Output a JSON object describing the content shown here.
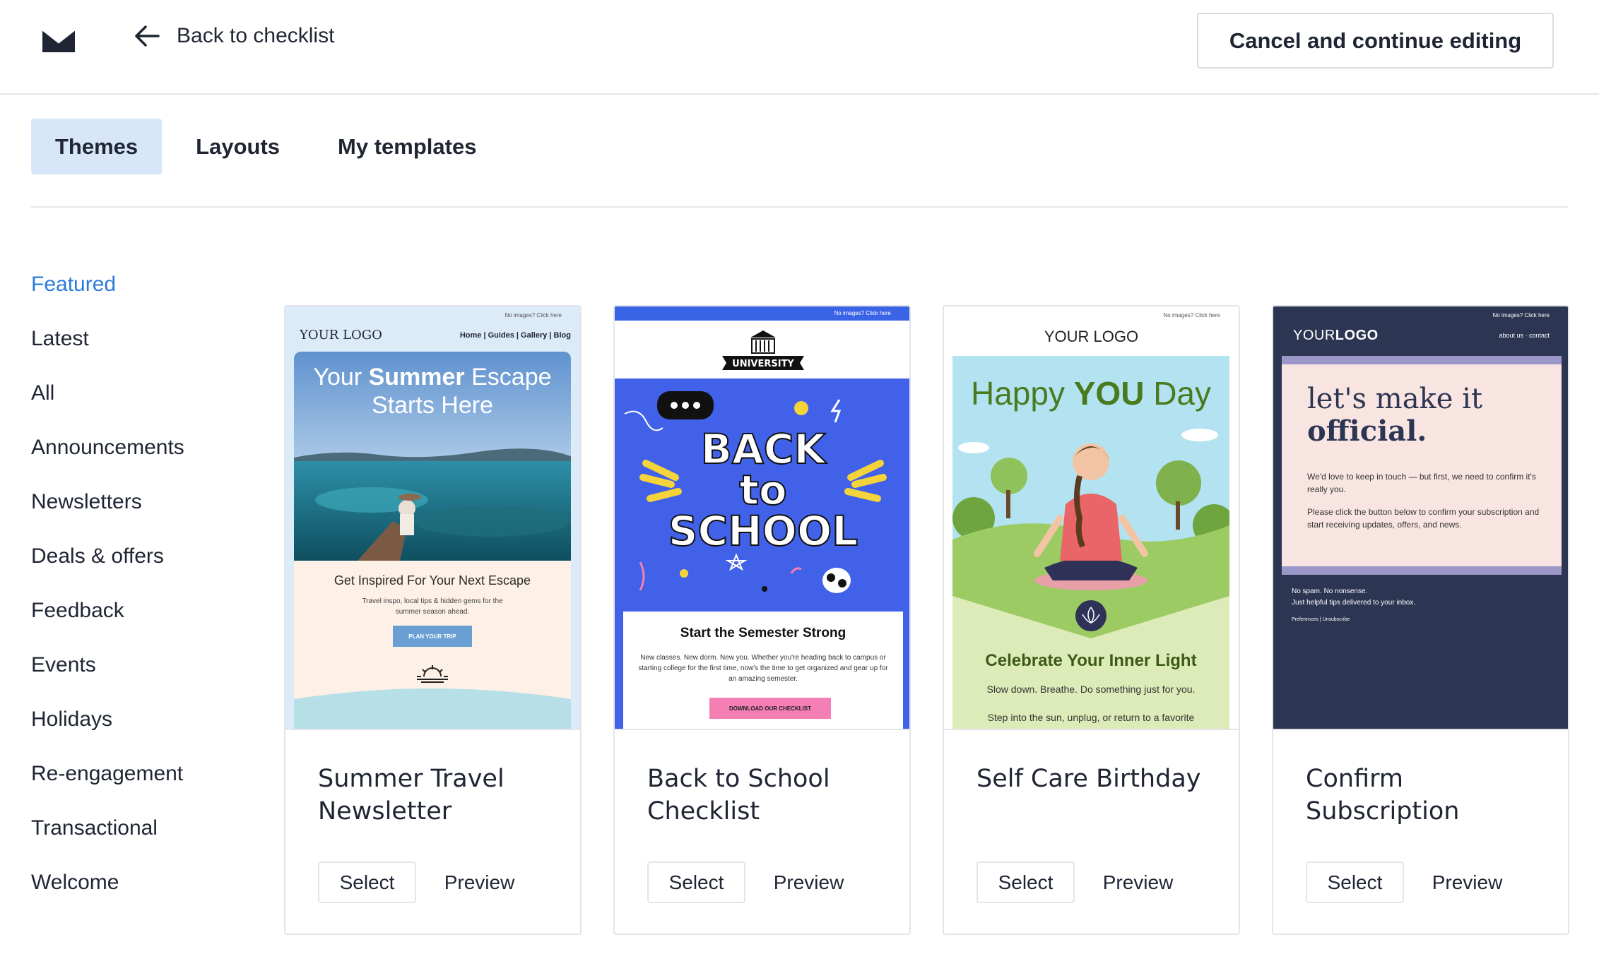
{
  "header": {
    "back_label": "Back to checklist",
    "cancel_label": "Cancel and continue editing"
  },
  "tabs": [
    {
      "label": "Themes",
      "active": true
    },
    {
      "label": "Layouts",
      "active": false
    },
    {
      "label": "My templates",
      "active": false
    }
  ],
  "sidebar": {
    "items": [
      {
        "label": "Featured",
        "active": true
      },
      {
        "label": "Latest"
      },
      {
        "label": "All"
      },
      {
        "label": "Announcements"
      },
      {
        "label": "Newsletters"
      },
      {
        "label": "Deals & offers"
      },
      {
        "label": "Feedback"
      },
      {
        "label": "Events"
      },
      {
        "label": "Holidays"
      },
      {
        "label": "Re-engagement"
      },
      {
        "label": "Transactional"
      },
      {
        "label": "Welcome"
      }
    ]
  },
  "cards": [
    {
      "title": "Summer Travel Newsletter",
      "select_label": "Select",
      "preview_label": "Preview",
      "thumb": {
        "no_images": "No images? Click here",
        "brand": "YOUR LOGO",
        "nav_links": "Home | Guides | Gallery | Blog",
        "hero_line1_pre": "Your ",
        "hero_line1_bold": "Summer",
        "hero_line1_post": " Escape",
        "hero_line2": "Starts Here",
        "subtitle": "Get Inspired For Your Next Escape",
        "body": "Travel inspo, local tips & hidden gems for the summer season ahead.",
        "cta": "PLAN YOUR TRIP"
      }
    },
    {
      "title": "Back to School Checklist",
      "select_label": "Select",
      "preview_label": "Preview",
      "thumb": {
        "no_images": "No images? Click here",
        "badge": "UNIVERSITY",
        "hero_word1": "BACK",
        "hero_word2": "to",
        "hero_word3": "SCHOOL",
        "heading": "Start the Semester Strong",
        "body": "New classes. New dorm. New you. Whether you're heading back to campus or starting college for the first time, now's the time to get organized and gear up for an amazing semester.",
        "cta": "DOWNLOAD OUR CHECKLIST"
      }
    },
    {
      "title": "Self Care Birthday",
      "select_label": "Select",
      "preview_label": "Preview",
      "thumb": {
        "no_images": "No images? Click here",
        "brand": "YOUR LOGO",
        "hl_pre": "Happy ",
        "hl_bold": "YOU",
        "hl_post": " Day",
        "heading": "Celebrate Your Inner Light",
        "line1": "Slow down. Breathe. Do something just for you.",
        "line2": "Step into the sun, unplug, or return to a favorite"
      }
    },
    {
      "title": "Confirm Subscription",
      "select_label": "Select",
      "preview_label": "Preview",
      "thumb": {
        "no_images": "No images? Click here",
        "brand_pre": "YOUR",
        "brand_bold": "LOGO",
        "links": "about us  ·  contact",
        "hl_line1": "let's make it",
        "hl_line2": "official.",
        "p1": "We'd love to keep in touch — but first, we need to confirm it's really you.",
        "p2": "Please click the button below to confirm your subscription and start receiving updates, offers, and news.",
        "foot1": "No spam. No nonsense.",
        "foot2": "Just helpful tips delivered to your inbox.",
        "foot_links": "Preferences | Unsubscribe"
      }
    }
  ],
  "colors": {
    "accent_blue": "#2b7bdb",
    "active_tab_bg": "#d8e6fa",
    "text": "#1f2533"
  }
}
